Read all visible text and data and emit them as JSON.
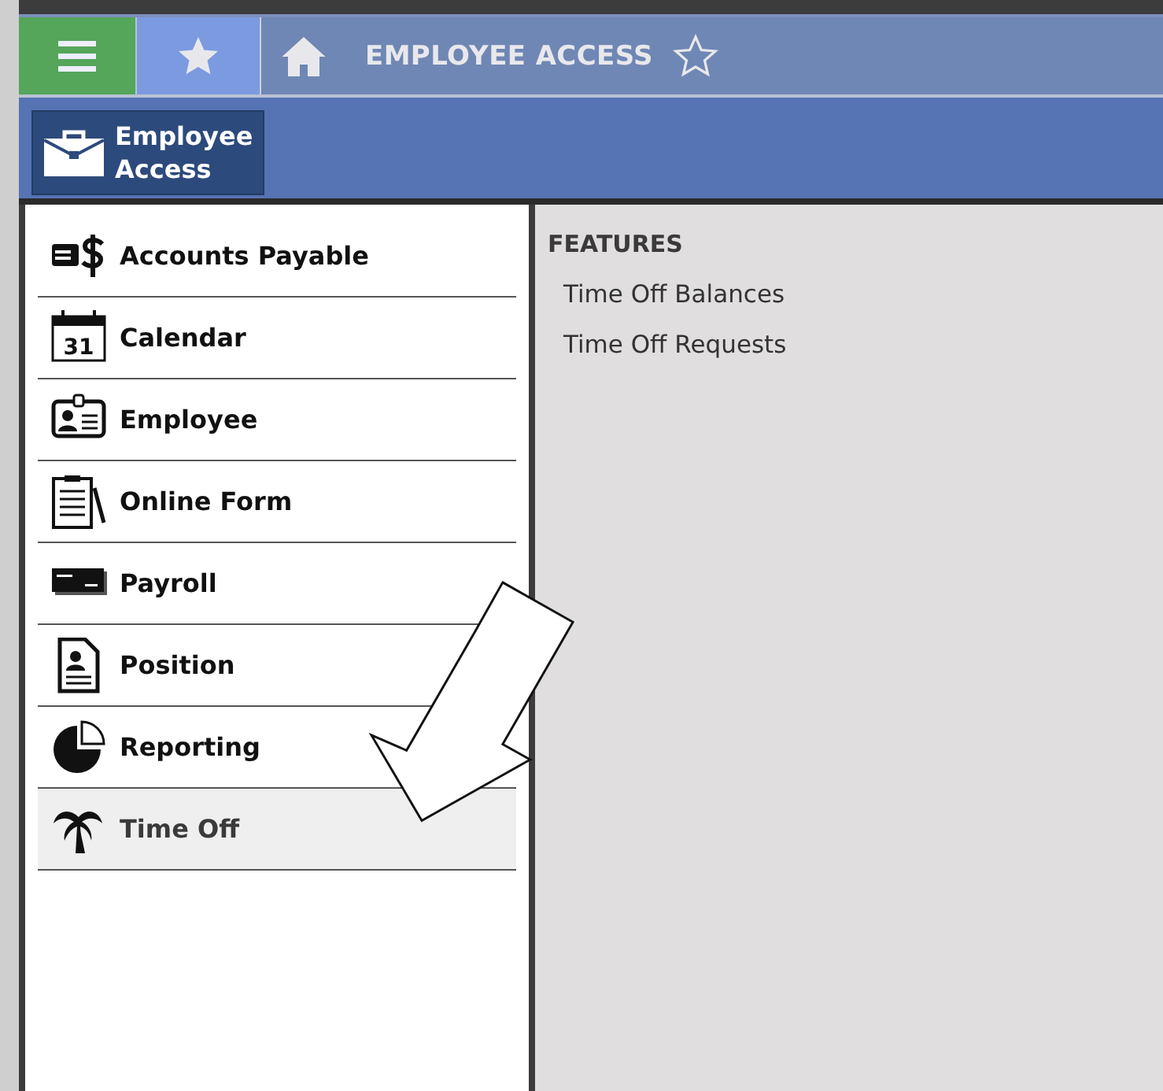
{
  "header": {
    "title": "EMPLOYEE ACCESS"
  },
  "module_button": {
    "label_lines": [
      "Employee",
      "Access"
    ]
  },
  "sidebar": {
    "items": [
      {
        "label": "Accounts Payable",
        "kind": "money",
        "selected": false
      },
      {
        "label": "Calendar",
        "kind": "calendar",
        "icon_text": "31",
        "selected": false
      },
      {
        "label": "Employee",
        "kind": "badge",
        "selected": false
      },
      {
        "label": "Online Form",
        "kind": "clipboard",
        "selected": false
      },
      {
        "label": "Payroll",
        "kind": "check",
        "selected": false
      },
      {
        "label": "Position",
        "kind": "document",
        "selected": false
      },
      {
        "label": "Reporting",
        "kind": "pie",
        "selected": false
      },
      {
        "label": "Time Off",
        "kind": "palm",
        "selected": true
      }
    ]
  },
  "features": {
    "heading": "FEATURES",
    "links": [
      "Time Off Balances",
      "Time Off Requests"
    ]
  }
}
